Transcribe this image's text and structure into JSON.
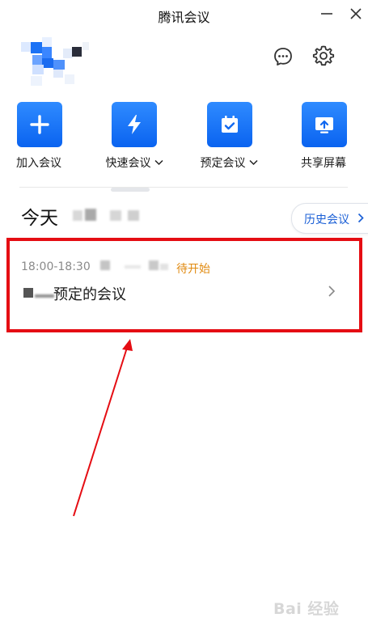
{
  "app": {
    "title": "腾讯会议"
  },
  "window_controls": {
    "minimize_icon": "minimize-icon",
    "close_icon": "close-icon"
  },
  "header": {
    "chat_icon": "message-icon",
    "settings_icon": "gear-icon"
  },
  "actions": [
    {
      "label": "加入会议",
      "icon": "plus-icon",
      "has_dropdown": false
    },
    {
      "label": "快速会议",
      "icon": "lightning-icon",
      "has_dropdown": true
    },
    {
      "label": "预定会议",
      "icon": "calendar-check-icon",
      "has_dropdown": true
    },
    {
      "label": "共享屏幕",
      "icon": "screen-share-icon",
      "has_dropdown": false
    }
  ],
  "today": {
    "heading": "今天",
    "history_button": "历史会议"
  },
  "meeting": {
    "time": "18:00-18:30",
    "status": "待开始",
    "title": "预定的会议"
  },
  "colors": {
    "accent_blue": "#0a63f0",
    "status_orange": "#e08a10",
    "highlight_red": "#e50d13",
    "history_text": "#1a5fd6"
  },
  "watermark": {
    "text": "Bai 经验"
  }
}
